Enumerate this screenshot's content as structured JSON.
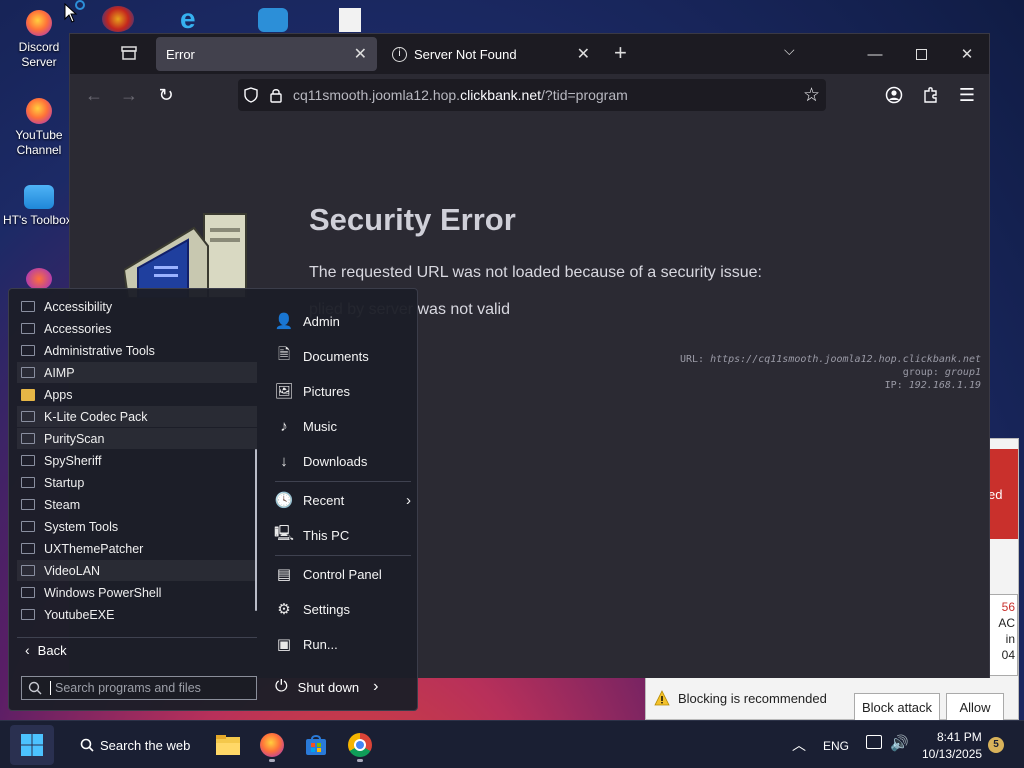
{
  "desktop": {
    "icons": [
      {
        "label": "Discord\nServer",
        "icon": "firefox-shortcut-icon"
      },
      {
        "label": "YouTube\nChannel",
        "icon": "firefox-shortcut-icon"
      },
      {
        "label": "HT's Toolbox",
        "icon": "folder-icon"
      }
    ]
  },
  "browser": {
    "tabs": [
      {
        "label": "Error",
        "active": true
      },
      {
        "label": "Server Not Found",
        "active": false
      }
    ],
    "url": {
      "prefix": "cq11smooth.joomla12.hop.",
      "host": "clickbank.net",
      "suffix": "/?tid=program"
    },
    "error": {
      "title": "Security Error",
      "message": "The requested URL was not loaded because of a security issue:",
      "detail": "plied by server was not valid",
      "meta_url_label": "URL: ",
      "meta_url": "https://cq11smooth.joomla12.hop.clickbank.net",
      "meta_group_label": "group: ",
      "meta_group": "group1",
      "meta_ip_label": "IP: ",
      "meta_ip": "192.168.1.19"
    }
  },
  "security_dialog": {
    "band_text": "ed",
    "side_lines": [
      "56",
      "AC",
      "in",
      "04"
    ],
    "warning": "Blocking is recommended",
    "block_button": "Block attack",
    "allow_button": "Allow"
  },
  "start_menu": {
    "apps": [
      {
        "label": "Accessibility",
        "type": "folder"
      },
      {
        "label": "Accessories",
        "type": "folder"
      },
      {
        "label": "Administrative Tools",
        "type": "folder"
      },
      {
        "label": "AIMP",
        "type": "folder"
      },
      {
        "label": "Apps",
        "type": "apps"
      },
      {
        "label": "K-Lite Codec Pack",
        "type": "folder"
      },
      {
        "label": "PurityScan",
        "type": "folder"
      },
      {
        "label": "SpySheriff",
        "type": "folder"
      },
      {
        "label": "Startup",
        "type": "folder"
      },
      {
        "label": "Steam",
        "type": "folder"
      },
      {
        "label": "System Tools",
        "type": "folder"
      },
      {
        "label": "UXThemePatcher",
        "type": "folder"
      },
      {
        "label": "VideoLAN",
        "type": "folder"
      },
      {
        "label": "Windows PowerShell",
        "type": "folder"
      },
      {
        "label": "YoutubeEXE",
        "type": "folder"
      }
    ],
    "back_label": "Back",
    "search_placeholder": "Search programs and files",
    "right": [
      {
        "label": "Admin",
        "icon": "user-icon"
      },
      {
        "label": "Documents",
        "icon": "document-icon"
      },
      {
        "label": "Pictures",
        "icon": "picture-icon"
      },
      {
        "label": "Music",
        "icon": "music-icon"
      },
      {
        "label": "Downloads",
        "icon": "download-icon"
      },
      {
        "label": "Recent",
        "icon": "clock-icon"
      },
      {
        "label": "This PC",
        "icon": "computer-icon"
      },
      {
        "label": "Control Panel",
        "icon": "control-panel-icon"
      },
      {
        "label": "Settings",
        "icon": "gear-icon"
      },
      {
        "label": "Run...",
        "icon": "run-icon"
      }
    ],
    "shutdown_label": "Shut down"
  },
  "taskbar": {
    "search_label": "Search the web",
    "language": "ENG",
    "time": "8:41 PM",
    "date": "10/13/2025",
    "notification_count": "5"
  },
  "colors": {
    "browser_bg": "#2b2a33",
    "taskbar_bg": "#1a1f33",
    "alert_red": "#c9302c"
  }
}
